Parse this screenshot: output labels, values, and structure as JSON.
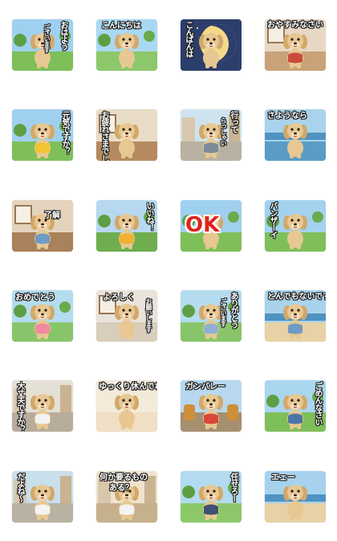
{
  "stickers": [
    {
      "caption": "おはよう",
      "caption2": "ございます",
      "scene": "grass",
      "sky": "#9fd0ef",
      "ground": "#7fbf5a",
      "shirt": ""
    },
    {
      "caption": "こんにちは",
      "caption2": "",
      "scene": "park",
      "sky": "#a9d9f2",
      "ground": "#8cc86a",
      "shirt": ""
    },
    {
      "caption": "こんばんは",
      "caption2": "",
      "scene": "night",
      "sky": "#2c3e6b",
      "ground": "#2c3e6b",
      "shirt": ""
    },
    {
      "caption": "おやすみなさい",
      "caption2": "",
      "scene": "room",
      "sky": "#e8d8c3",
      "ground": "#c9a27a",
      "shirt": "#c94b3b"
    },
    {
      "caption": "元気ですか？",
      "caption2": "",
      "scene": "grass",
      "sky": "#9fd0ef",
      "ground": "#7fbf5a",
      "shirt": "#f2c531"
    },
    {
      "caption": "お疲れさまでした",
      "caption2": "",
      "scene": "cafe",
      "sky": "#e9dcc7",
      "ground": "#b68a60",
      "shirt": ""
    },
    {
      "caption": "行って",
      "caption2": "らっしゃい",
      "scene": "town",
      "sky": "#cfe3ee",
      "ground": "#b9b2a2",
      "shirt": "#7c8a9a"
    },
    {
      "caption": "さようなら",
      "caption2": "",
      "scene": "sea",
      "sky": "#a9d3ec",
      "ground": "#5a9cc4",
      "shirt": ""
    },
    {
      "caption": "了解",
      "caption2": "",
      "scene": "room",
      "sky": "#e4d3bd",
      "ground": "#a9815b",
      "shirt": "#6f9bc4"
    },
    {
      "caption": "いいね！",
      "caption2": "",
      "scene": "grass",
      "sky": "#b7d9ef",
      "ground": "#6fae4f",
      "shirt": "#f2b035"
    },
    {
      "caption": "OK",
      "caption2": "",
      "scene": "grass",
      "sky": "#9fd0ef",
      "ground": "#7fbf5a",
      "shirt": ""
    },
    {
      "caption": "バンザーイ",
      "caption2": "",
      "scene": "grass",
      "sky": "#a3d2ef",
      "ground": "#7fbf5a",
      "shirt": ""
    },
    {
      "caption": "おめでとう",
      "caption2": "",
      "scene": "garden",
      "sky": "#b4dcef",
      "ground": "#88c56a",
      "shirt": "#f08aa0"
    },
    {
      "caption": "よろしく",
      "caption2": "お願いします",
      "scene": "home",
      "sky": "#e9e3da",
      "ground": "#d9cdbb",
      "shirt": ""
    },
    {
      "caption": "ありがとう",
      "caption2": "ございます",
      "scene": "garden",
      "sky": "#b4dcef",
      "ground": "#88c56a",
      "shirt": "#8fb1cf"
    },
    {
      "caption": "とんでもないです",
      "caption2": "",
      "scene": "beach",
      "sky": "#a9d3ec",
      "ground": "#e7d2a6",
      "shirt": "#6f9bc4"
    },
    {
      "caption": "大丈夫ですか？",
      "caption2": "",
      "scene": "shop",
      "sky": "#e4e0d6",
      "ground": "#b8ad9c",
      "shirt": "#f3f3f3"
    },
    {
      "caption": "ゆっくり休んでね",
      "caption2": "",
      "scene": "soft",
      "sky": "#f4ead9",
      "ground": "#f0dfc4",
      "shirt": ""
    },
    {
      "caption": "ガンバレー",
      "caption2": "",
      "scene": "festival",
      "sky": "#b7d8ee",
      "ground": "#a58f6f",
      "shirt": "#d7473a"
    },
    {
      "caption": "ごめんなさい",
      "caption2": "",
      "scene": "field",
      "sky": "#a9d6ef",
      "ground": "#7fbf5a",
      "shirt": "#4d74a6"
    },
    {
      "caption": "だよね〜",
      "caption2": "",
      "scene": "town",
      "sky": "#c9dfec",
      "ground": "#b9b2a2",
      "shirt": "#f3f3f3"
    },
    {
      "caption": "何か要るもの",
      "caption2": "ある？",
      "scene": "shop",
      "sky": "#efe3cf",
      "ground": "#c7b08c",
      "shirt": "#f3f3f3"
    },
    {
      "caption": "任せろー",
      "caption2": "",
      "scene": "park",
      "sky": "#b2dbef",
      "ground": "#8cc86a",
      "shirt": "#3f5170"
    },
    {
      "caption": "エェー",
      "caption2": "",
      "scene": "beach",
      "sky": "#a6d2ee",
      "ground": "#e7d2a6",
      "shirt": ""
    }
  ]
}
